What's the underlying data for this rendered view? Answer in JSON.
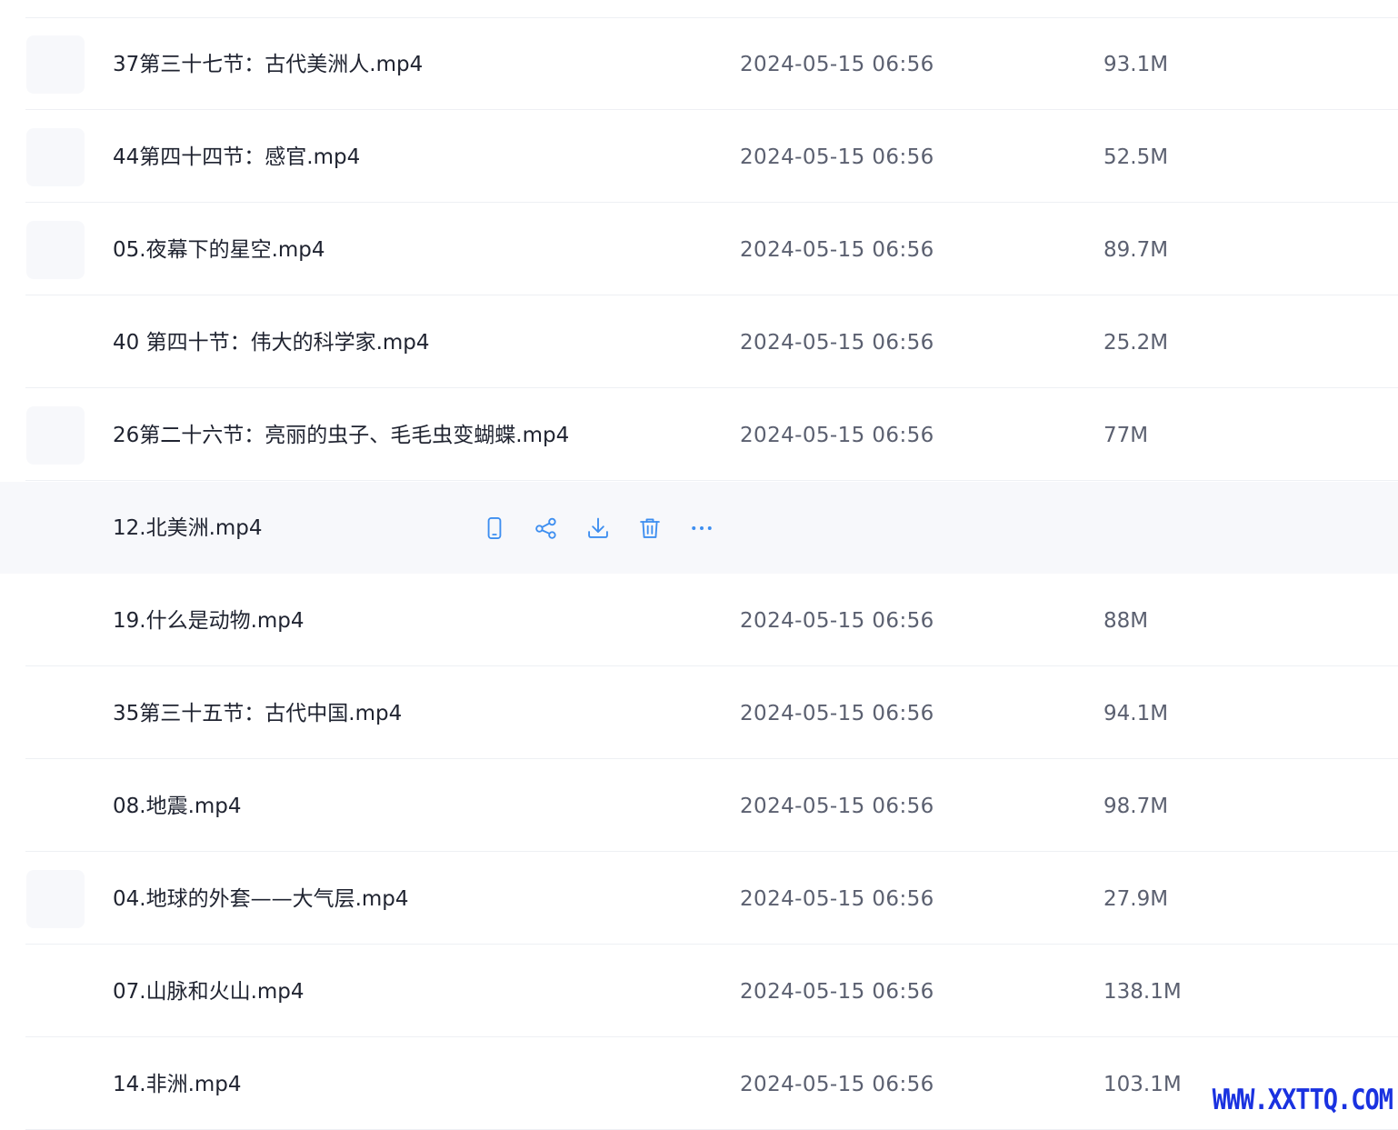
{
  "theme": {
    "accent": "#3d8ef0",
    "row_hover_bg": "#f7f8fb",
    "divider": "#eef0f4",
    "name_color": "#1f2330",
    "meta_color": "#5b6070",
    "watermark_color": "#1a32e0"
  },
  "files": [
    {
      "name": "37第三十七节：古代美洲人.mp4",
      "date": "2024-05-15 06:56",
      "size": "93.1M",
      "thumbnail": true
    },
    {
      "name": "44第四十四节：感官.mp4",
      "date": "2024-05-15 06:56",
      "size": "52.5M",
      "thumbnail": true
    },
    {
      "name": "05.夜幕下的星空.mp4",
      "date": "2024-05-15 06:56",
      "size": "89.7M",
      "thumbnail": true
    },
    {
      "name": "40 第四十节：伟大的科学家.mp4",
      "date": "2024-05-15 06:56",
      "size": "25.2M",
      "thumbnail": false
    },
    {
      "name": "26第二十六节：亮丽的虫子、毛毛虫变蝴蝶.mp4",
      "date": "2024-05-15 06:56",
      "size": "77M",
      "thumbnail": true
    },
    {
      "name": "12.北美洲.mp4",
      "date": "",
      "size": "",
      "thumbnail": false,
      "hovered": true
    },
    {
      "name": "19.什么是动物.mp4",
      "date": "2024-05-15 06:56",
      "size": "88M",
      "thumbnail": false
    },
    {
      "name": "35第三十五节：古代中国.mp4",
      "date": "2024-05-15 06:56",
      "size": "94.1M",
      "thumbnail": false
    },
    {
      "name": "08.地震.mp4",
      "date": "2024-05-15 06:56",
      "size": "98.7M",
      "thumbnail": false
    },
    {
      "name": "04.地球的外套——大气层.mp4",
      "date": "2024-05-15 06:56",
      "size": "27.9M",
      "thumbnail": true
    },
    {
      "name": "07.山脉和火山.mp4",
      "date": "2024-05-15 06:56",
      "size": "138.1M",
      "thumbnail": false
    },
    {
      "name": "14.非洲.mp4",
      "date": "2024-05-15 06:56",
      "size": "103.1M",
      "thumbnail": false
    }
  ],
  "row_actions": [
    {
      "icon": "phone-icon",
      "name": "send-to-phone-button"
    },
    {
      "icon": "share-icon",
      "name": "share-button"
    },
    {
      "icon": "download-icon",
      "name": "download-button"
    },
    {
      "icon": "trash-icon",
      "name": "delete-button"
    },
    {
      "icon": "more-icon",
      "name": "more-button"
    }
  ],
  "watermark": {
    "text": "WWW.XXTTQ.COM"
  }
}
